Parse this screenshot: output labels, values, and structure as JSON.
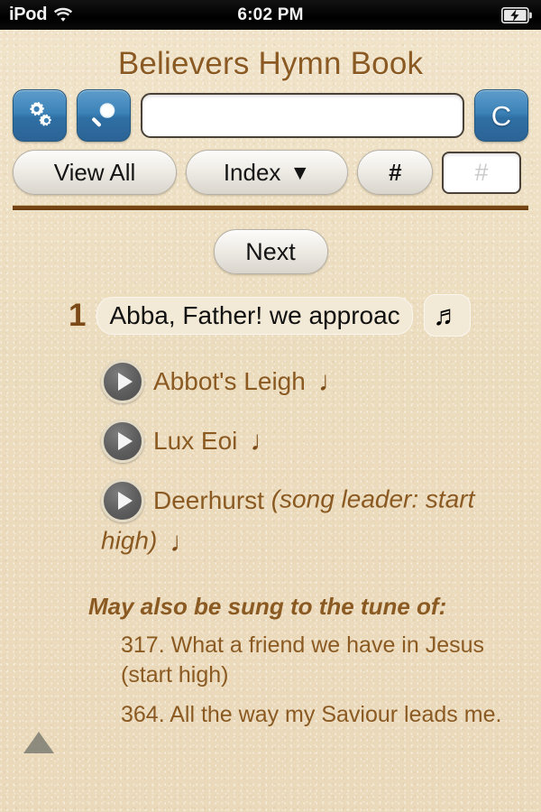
{
  "statusbar": {
    "carrier": "iPod",
    "wifi_icon": "wifi-icon",
    "time": "6:02 PM",
    "battery_icon": "battery-charging-icon"
  },
  "header": {
    "title": "Believers Hymn Book",
    "title_color": "#8a5a22"
  },
  "toolbar": {
    "settings_button": {
      "icon": "gears-icon",
      "label": ""
    },
    "search_button": {
      "icon": "magnifier-icon",
      "label": ""
    },
    "search_input": {
      "value": "",
      "placeholder": ""
    },
    "clear_button": {
      "label": "C"
    },
    "view_all_button": {
      "label": "View All"
    },
    "index_button": {
      "label": "Index",
      "caret": "▼"
    },
    "hash_button": {
      "label": "#"
    },
    "hash_input": {
      "value": "",
      "placeholder": "#"
    },
    "accent_blue": "#3c82b8"
  },
  "content": {
    "next_button": {
      "label": "Next"
    },
    "hymn": {
      "number": "1",
      "title": "Abba, Father! we approac",
      "music_icon": "♬"
    },
    "tunes": [
      {
        "name": "Abbot's Leigh",
        "hint": "",
        "note": "♩"
      },
      {
        "name": "Lux Eoi",
        "hint": "",
        "note": "♩"
      },
      {
        "name": "Deerhurst",
        "hint": "(song leader: start high)",
        "note": "♩"
      }
    ],
    "alt_header": "May also be sung to the tune of:",
    "alt_tunes": [
      "317. What a friend we have in Jesus (start high)",
      "364. All the way my Saviour leads me."
    ],
    "scroll_up_icon": "triangle-up-icon",
    "text_color": "#8a5a22"
  }
}
